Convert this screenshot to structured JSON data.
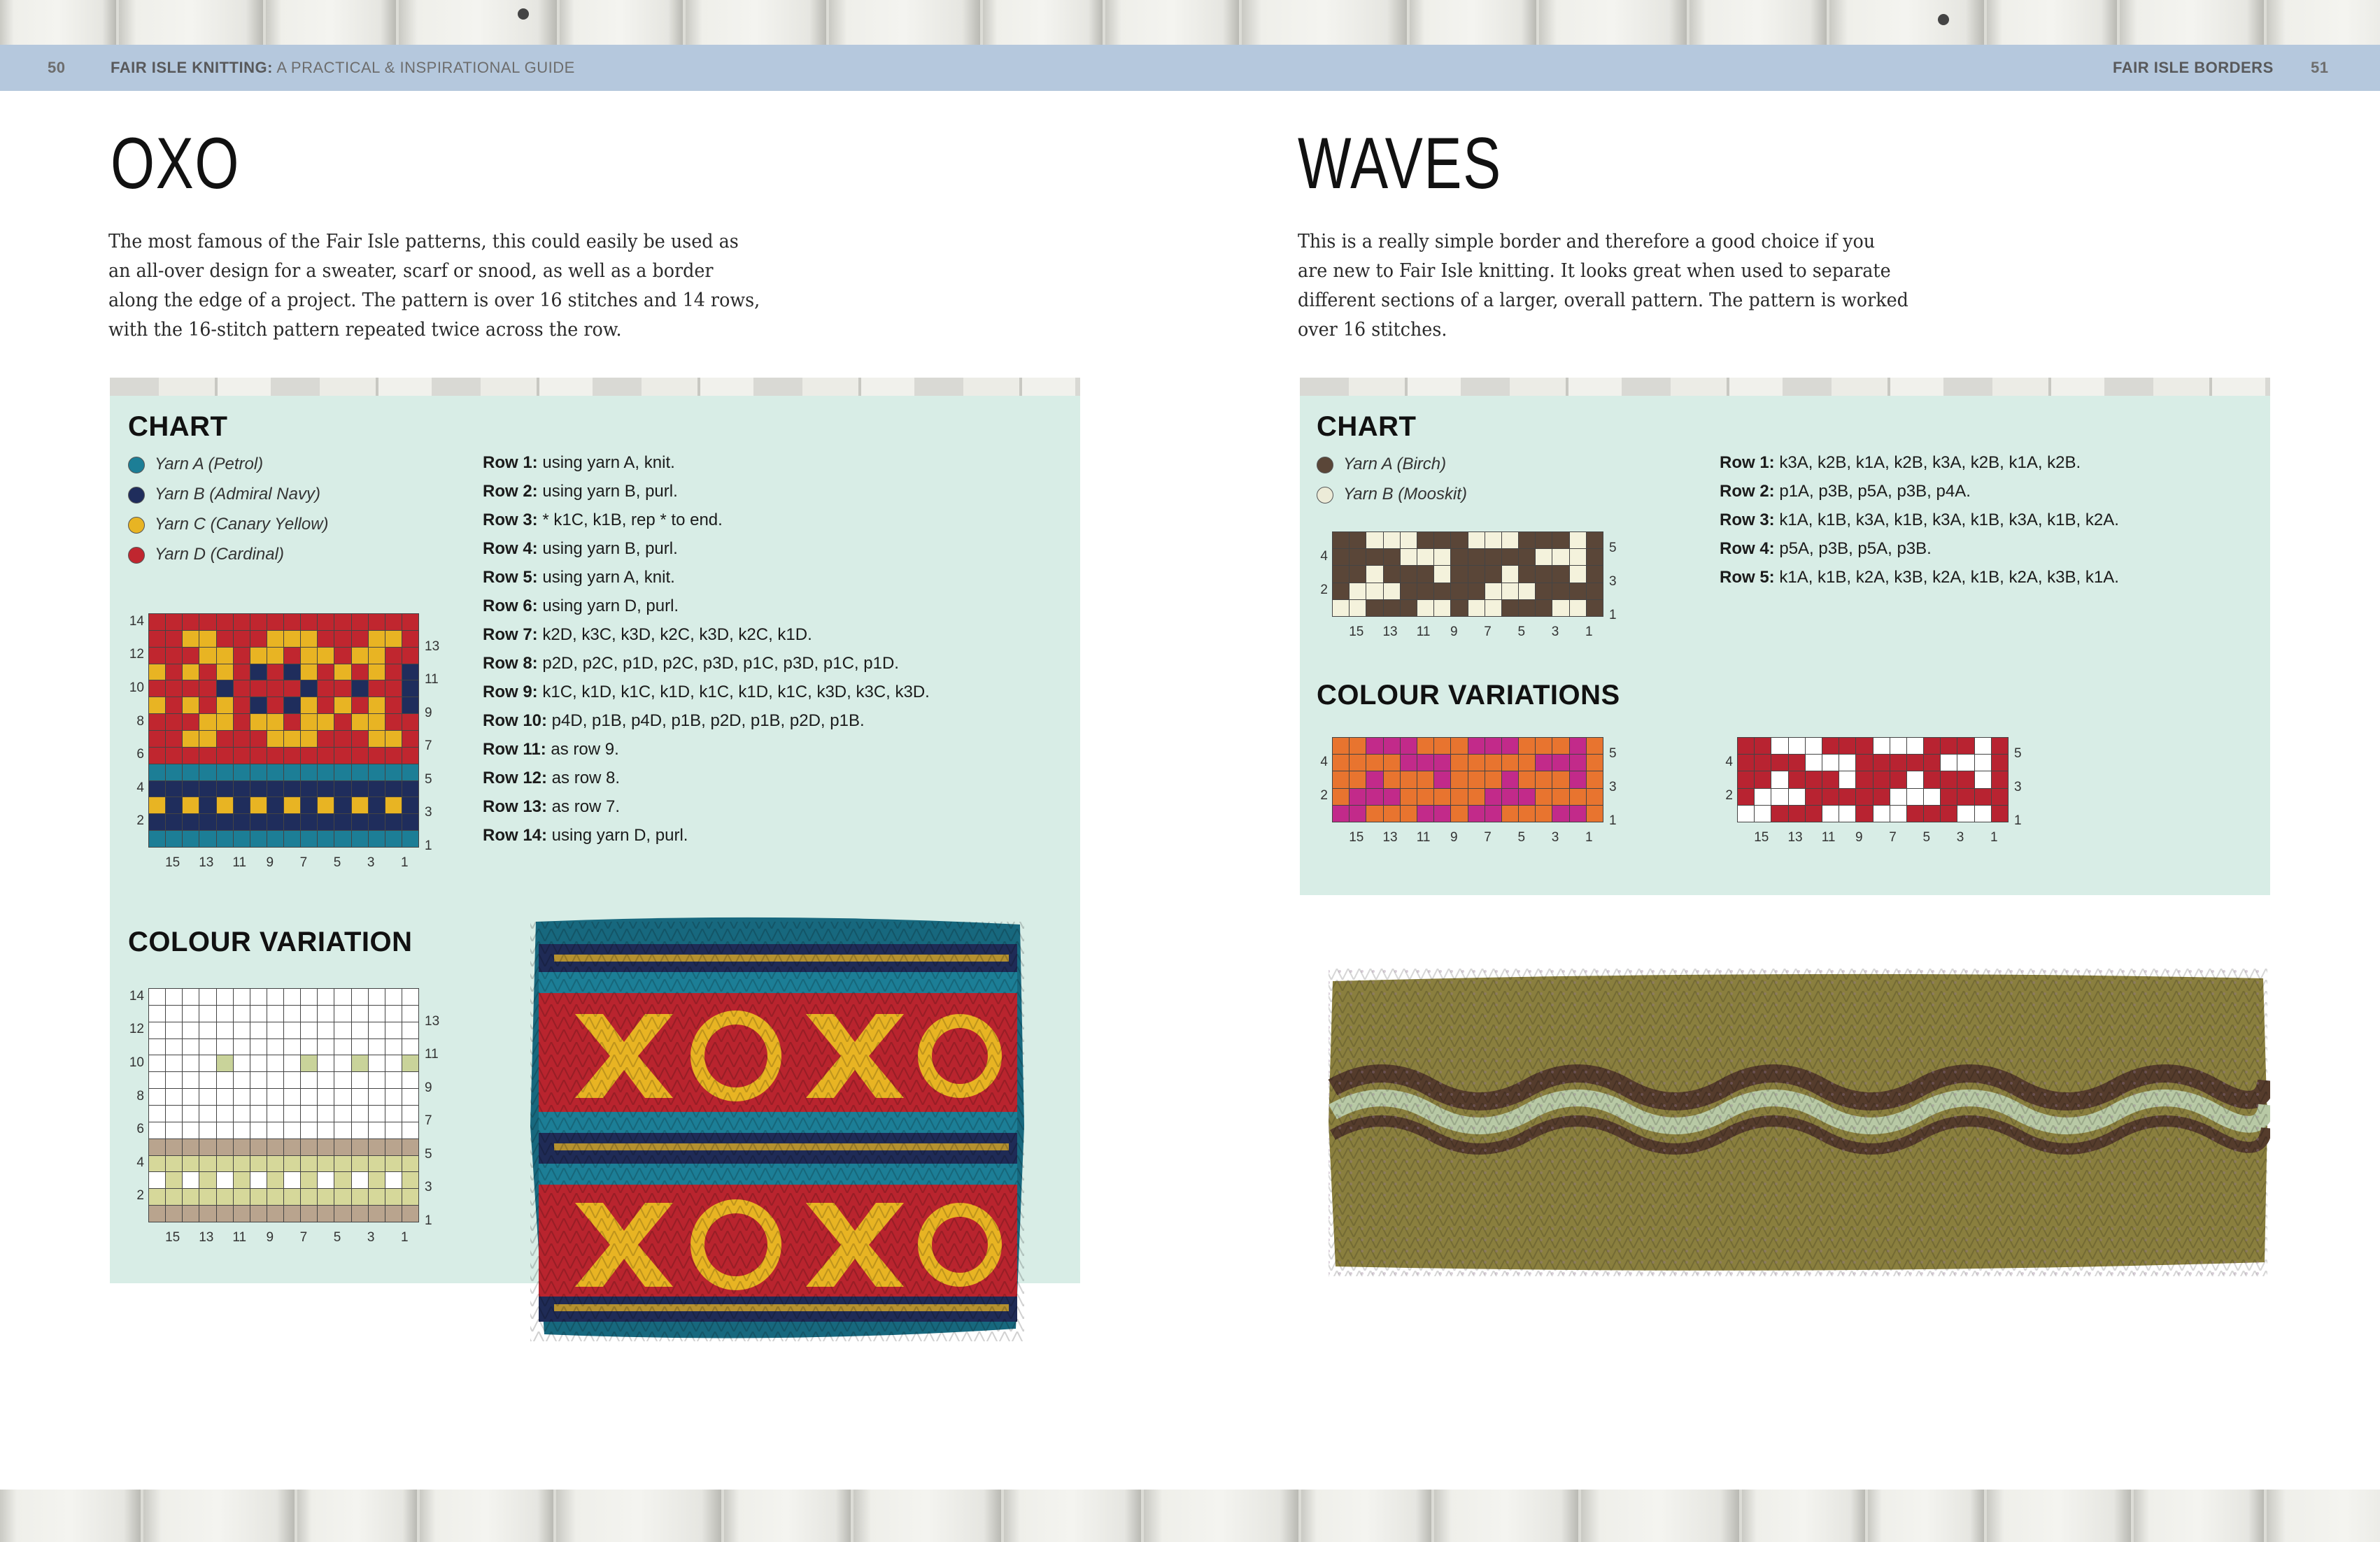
{
  "header": {
    "left_page": "50",
    "book_title_bold": "FAIR ISLE KNITTING:",
    "book_title_rest": " A PRACTICAL & INSPIRATIONAL GUIDE",
    "section": "FAIR ISLE BORDERS",
    "right_page": "51"
  },
  "oxo": {
    "title": "OXO",
    "intro": [
      "The most famous of the Fair Isle patterns, this could easily be used as",
      "an all-over design for a sweater, scarf or snood, as well as a border",
      "along the edge of a project. The pattern is over 16 stitches and 14 rows,",
      "with the 16-stitch pattern repeated twice across the row."
    ],
    "chart_heading": "CHART",
    "legend": [
      {
        "label": "Yarn A (Petrol)",
        "color": "#1c7e96"
      },
      {
        "label": "Yarn B (Admiral Navy)",
        "color": "#1f2d5c"
      },
      {
        "label": "Yarn C (Canary Yellow)",
        "color": "#e8b423"
      },
      {
        "label": "Yarn D (Cardinal)",
        "color": "#c0262f"
      }
    ],
    "rows": [
      {
        "label": "Row 1:",
        "text": " using yarn A, knit."
      },
      {
        "label": "Row 2:",
        "text": " using yarn B, purl."
      },
      {
        "label": "Row 3:",
        "text": " * k1C, k1B, rep * to end."
      },
      {
        "label": "Row 4:",
        "text": " using yarn B, purl."
      },
      {
        "label": "Row 5:",
        "text": " using yarn A, knit."
      },
      {
        "label": "Row 6:",
        "text": " using yarn D, purl."
      },
      {
        "label": "Row 7:",
        "text": " k2D, k3C, k3D, k2C, k3D, k2C, k1D."
      },
      {
        "label": "Row 8:",
        "text": " p2D, p2C, p1D, p2C, p3D, p1C, p3D, p1C, p1D."
      },
      {
        "label": "Row 9:",
        "text": " k1C, k1D, k1C, k1D, k1C, k1D, k1C, k3D, k3C, k3D."
      },
      {
        "label": "Row 10:",
        "text": " p4D, p1B, p4D, p1B, p2D, p1B, p2D, p1B."
      },
      {
        "label": "Row 11:",
        "text": " as row 9."
      },
      {
        "label": "Row 12:",
        "text": " as row 8."
      },
      {
        "label": "Row 13:",
        "text": " as row 7."
      },
      {
        "label": "Row 14:",
        "text": " using yarn D, purl."
      }
    ],
    "variation_heading": "COLOUR VARIATION",
    "chart_colors": {
      "A": "#1c7e96",
      "B": "#1f2d5c",
      "C": "#e8b423",
      "D": "#c0262f"
    },
    "variation_colors": {
      "A": "#b9a48e",
      "B": "#d6d89a",
      "C": "#ffffff",
      "D": "#ffffff",
      "X": "#c9d39a"
    },
    "left_ticks": [
      "14",
      "12",
      "10",
      "8",
      "6",
      "4",
      "2"
    ],
    "right_ticks": [
      "13",
      "11",
      "9",
      "7",
      "5",
      "3",
      "1"
    ],
    "bottom_ticks": [
      "15",
      "13",
      "11",
      "9",
      "7",
      "5",
      "3",
      "1"
    ]
  },
  "waves": {
    "title": "WAVES",
    "intro": [
      "This is a really simple border and therefore a good choice if you",
      "are new to Fair Isle knitting. It looks great when used to separate",
      "different sections of a larger, overall pattern. The pattern is worked",
      "over 16 stitches."
    ],
    "chart_heading": "CHART",
    "legend": [
      {
        "label": "Yarn A (Birch)",
        "color": "#5a4638"
      },
      {
        "label": "Yarn B (Mooskit)",
        "color": "#ecebd8"
      }
    ],
    "rows": [
      {
        "label": "Row 1:",
        "text": " k3A, k2B, k1A, k2B, k3A, k2B, k1A, k2B."
      },
      {
        "label": "Row 2:",
        "text": " p1A, p3B, p5A, p3B, p4A."
      },
      {
        "label": "Row 3:",
        "text": " k1A, k1B, k3A, k1B, k3A, k1B, k3A, k1B, k2A."
      },
      {
        "label": "Row 4:",
        "text": " p5A, p3B, p5A, p3B."
      },
      {
        "label": "Row 5:",
        "text": " k1A, k1B, k2A, k3B, k2A, k1B, k2A, k3B, k1A."
      }
    ],
    "variations_heading": "COLOUR VARIATIONS",
    "chart_colors": {
      "A": "#5a4638",
      "B": "#f4f2dc"
    },
    "variation1_colors": {
      "A": "#e8742f",
      "B": "#c22a8a"
    },
    "variation2_colors": {
      "A": "#b82331",
      "B": "#ffffff"
    },
    "left_ticks": [
      "4",
      "2"
    ],
    "right_ticks": [
      "5",
      "3",
      "1"
    ],
    "bottom_ticks": [
      "15",
      "13",
      "11",
      "9",
      "7",
      "5",
      "3",
      "1"
    ]
  }
}
